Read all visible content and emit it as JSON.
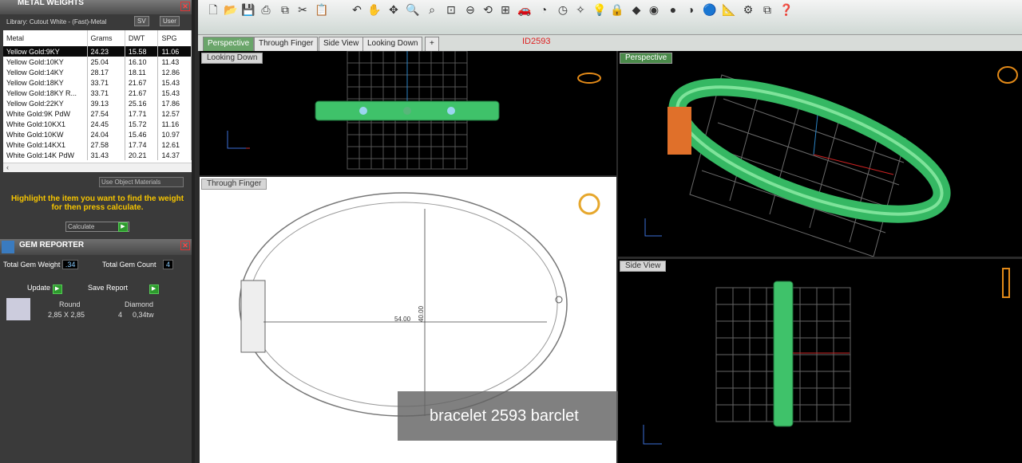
{
  "metal_panel": {
    "title": "METAL WEIGHTS",
    "library_label": "Library: Cutout White - (Fast)-Metal",
    "sv_label": "SV",
    "user_label": "User",
    "columns": [
      "Metal",
      "Grams",
      "DWT",
      "SPG"
    ],
    "rows": [
      [
        "Yellow Gold:9KY",
        "24.23",
        "15.58",
        "11.06"
      ],
      [
        "Yellow Gold:10KY",
        "25.04",
        "16.10",
        "11.43"
      ],
      [
        "Yellow Gold:14KY",
        "28.17",
        "18.11",
        "12.86"
      ],
      [
        "Yellow Gold:18KY",
        "33.71",
        "21.67",
        "15.43"
      ],
      [
        "Yellow Gold:18KY R...",
        "33.71",
        "21.67",
        "15.43"
      ],
      [
        "Yellow Gold:22KY",
        "39.13",
        "25.16",
        "17.86"
      ],
      [
        "White Gold:9K PdW",
        "27.54",
        "17.71",
        "12.57"
      ],
      [
        "White Gold:10KX1",
        "24.45",
        "15.72",
        "11.16"
      ],
      [
        "White Gold:10KW",
        "24.04",
        "15.46",
        "10.97"
      ],
      [
        "White Gold:14KX1",
        "27.58",
        "17.74",
        "12.61"
      ],
      [
        "White Gold:14K PdW",
        "31.43",
        "20.21",
        "14.37"
      ]
    ],
    "use_object_materials": "Use Object Materials",
    "hint": "Highlight the item you want to find the weight for then press calculate.",
    "calculate_label": "Calculate"
  },
  "gem_panel": {
    "title": "GEM REPORTER",
    "total_weight_label": "Total Gem Weight",
    "total_weight_value": ".34",
    "total_count_label": "Total Gem Count",
    "total_count_value": "4",
    "update_label": "Update",
    "save_report_label": "Save Report",
    "headers": [
      "Round",
      "Diamond"
    ],
    "row": [
      "2,85 X 2,85",
      "4",
      "0,34tw"
    ]
  },
  "tabs": [
    "Perspective",
    "Through Finger",
    "Side View",
    "Looking Down",
    "+"
  ],
  "model_id": "ID2593",
  "viewports": {
    "top_left": "Looking Down",
    "top_right": "Perspective",
    "bottom_left": "Through Finger",
    "bottom_right": "Side View"
  },
  "dimensions": {
    "width": "54.00",
    "height": "40.00"
  },
  "caption": "bracelet 2593 barclet",
  "colors": {
    "accent_green": "#3fc26a",
    "hint_yellow": "#f5c400",
    "id_red": "#dd2222"
  }
}
